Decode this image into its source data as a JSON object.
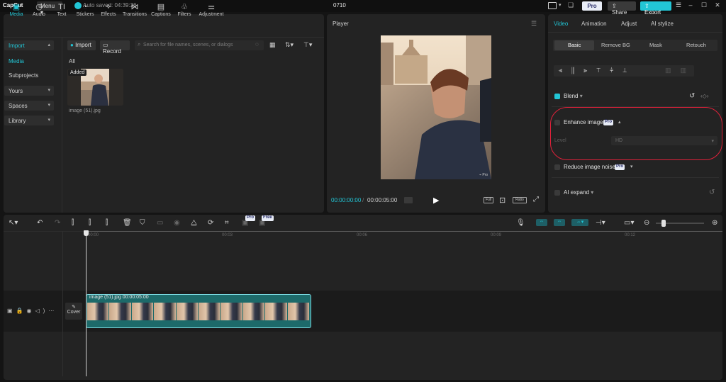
{
  "titlebar": {
    "app_name": "CapCut",
    "menu_label": "Menu",
    "autosave": "Auto saved: 04:39:26",
    "project_title": "0710",
    "pro_label": "Pro",
    "share_label": "Share",
    "export_label": "Export"
  },
  "toolbar": {
    "items": [
      {
        "label": "Media",
        "icon": "media-icon"
      },
      {
        "label": "Audio",
        "icon": "audio-icon"
      },
      {
        "label": "Text",
        "icon": "text-icon"
      },
      {
        "label": "Stickers",
        "icon": "stickers-icon"
      },
      {
        "label": "Effects",
        "icon": "effects-icon"
      },
      {
        "label": "Transitions",
        "icon": "transitions-icon"
      },
      {
        "label": "Captions",
        "icon": "captions-icon"
      },
      {
        "label": "Filters",
        "icon": "filters-icon"
      },
      {
        "label": "Adjustment",
        "icon": "adjustment-icon"
      }
    ]
  },
  "media": {
    "nav": {
      "import": "Import",
      "media": "Media",
      "subprojects": "Subprojects",
      "yours": "Yours",
      "spaces": "Spaces",
      "library": "Library"
    },
    "import_button": "Import",
    "record_button": "Record",
    "search_placeholder": "Search for file names, scenes, or dialogs",
    "filter_all": "All",
    "item": {
      "badge": "Added",
      "name": "image (51).jpg"
    }
  },
  "player": {
    "title": "Player",
    "current_time": "00:00:00:00",
    "duration": "00:00:05:00",
    "full_label": "Full",
    "ratio_label": "Ratio"
  },
  "properties": {
    "tabs": [
      "Video",
      "Animation",
      "Adjust",
      "AI stylize"
    ],
    "subtabs": [
      "Basic",
      "Remove BG",
      "Mask",
      "Retouch"
    ],
    "blend_label": "Blend",
    "enhance_label": "Enhance image",
    "enhance_pro": "Pro",
    "level_label": "Level",
    "level_value": "HD",
    "reduce_noise_label": "Reduce image noise",
    "reduce_noise_pro": "Pro",
    "ai_expand_label": "AI expand"
  },
  "timeline": {
    "pro_badge": "Pro",
    "free_badge": "Free",
    "ruler": [
      "00:00",
      "00:03",
      "00:06",
      "00:09",
      "00:12"
    ],
    "clip_label": "image (51).jpg   00:00:05:00",
    "cover_label": "Cover"
  },
  "colors": {
    "accent": "#22c6d6",
    "highlight_ring": "#e0213a"
  }
}
